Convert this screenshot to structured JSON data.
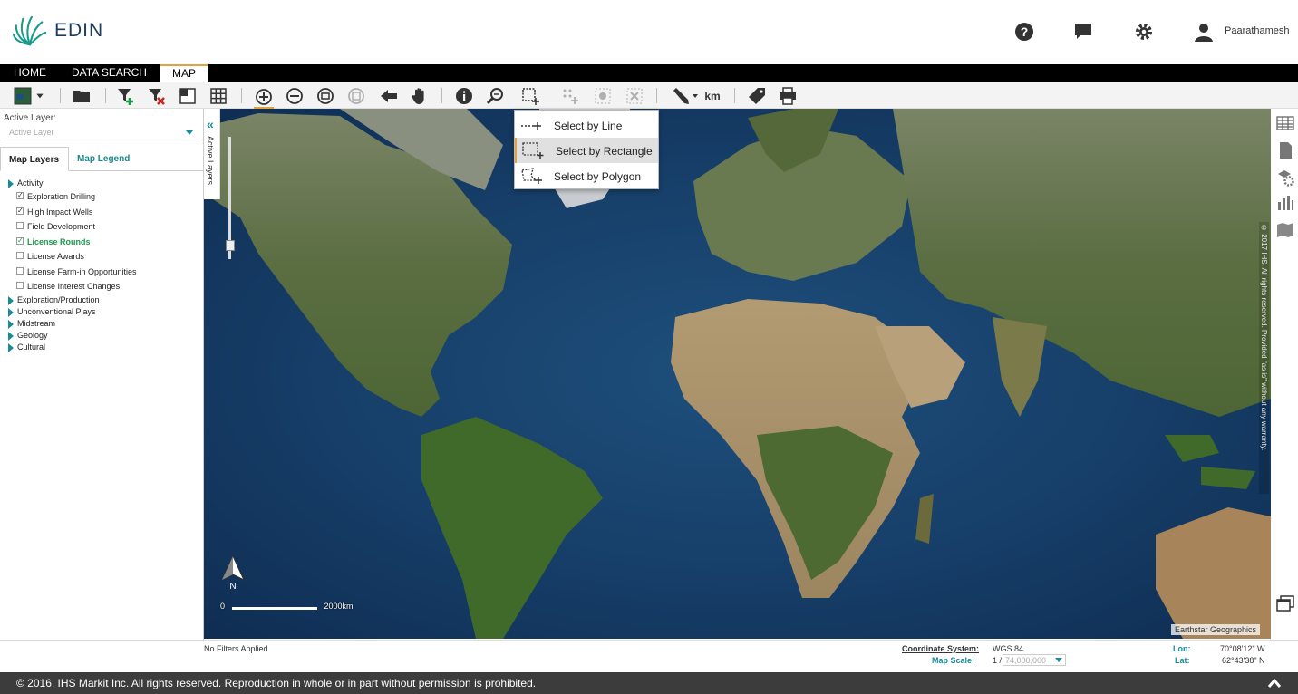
{
  "header": {
    "logo_text": "EDIN",
    "user_name": "Paarathamesh"
  },
  "nav": {
    "tabs": [
      {
        "label": "HOME",
        "active": false
      },
      {
        "label": "DATA SEARCH",
        "active": false
      },
      {
        "label": "MAP",
        "active": true
      }
    ]
  },
  "left_panel": {
    "active_layer_label": "Active Layer:",
    "active_layer_placeholder": "Active Layer",
    "tabs": [
      {
        "label": "Map Layers",
        "active": true
      },
      {
        "label": "Map Legend",
        "active": false
      }
    ],
    "tree": {
      "activity": {
        "label": "Activity",
        "items": [
          {
            "label": "Exploration Drilling",
            "checked": true
          },
          {
            "label": "High Impact Wells",
            "checked": true
          },
          {
            "label": "Field Development",
            "checked": false
          },
          {
            "label": "License Rounds",
            "checked": true,
            "highlight": true
          },
          {
            "label": "License Awards",
            "checked": false
          },
          {
            "label": "License Farm-in Opportunities",
            "checked": false
          },
          {
            "label": "License Interest Changes",
            "checked": false
          }
        ]
      },
      "groups": [
        {
          "label": "Exploration/Production"
        },
        {
          "label": "Unconventional Plays"
        },
        {
          "label": "Midstream"
        },
        {
          "label": "Geology"
        },
        {
          "label": "Cultural"
        }
      ]
    }
  },
  "active_layers_strip": {
    "label": "Active Layers"
  },
  "select_menu": {
    "items": [
      {
        "label": "Select by Line",
        "selected": false
      },
      {
        "label": "Select by Rectangle",
        "selected": true
      },
      {
        "label": "Select by Polygon",
        "selected": false
      }
    ]
  },
  "map": {
    "north_label": "N",
    "scale_zero": "0",
    "scale_label": "2000km",
    "attribution": "Earthstar Geographics",
    "copyright_vertical": "© 2017 IHS. All rights reserved. Provided \"as is\" without any warranty."
  },
  "toolbar": {
    "measure_unit": "km"
  },
  "status_bar": {
    "filters": "No Filters Applied",
    "coordinate_system_label": "Coordinate System:",
    "coordinate_system_value": "WGS 84",
    "map_scale_label": "Map Scale:",
    "map_scale_prefix": "1 /",
    "map_scale_value": "74,000,000",
    "lon_label": "Lon:",
    "lon_value": "70°08'12\" W",
    "lat_label": "Lat:",
    "lat_value": "62°43'38\" N"
  },
  "footer": {
    "text": "© 2016, IHS Markit Inc. All rights reserved. Reproduction in whole or in part without permission is prohibited."
  }
}
